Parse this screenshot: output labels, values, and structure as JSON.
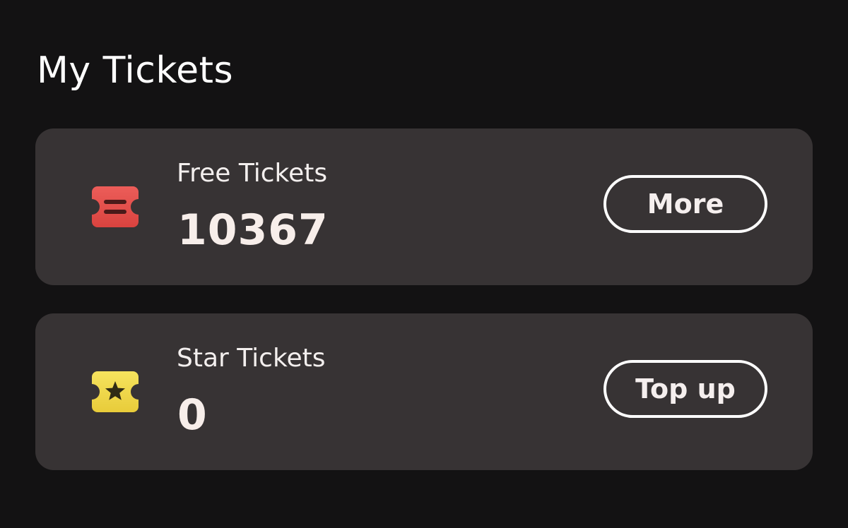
{
  "header": {
    "title": "My Tickets"
  },
  "cards": {
    "free": {
      "label": "Free Tickets",
      "count": "10367",
      "button_label": "More",
      "icon": "ticket-icon",
      "icon_color": "#e5524f"
    },
    "star": {
      "label": "Star Tickets",
      "count": "0",
      "button_label": "Top up",
      "icon": "star-ticket-icon",
      "icon_color": "#f0d84a"
    }
  },
  "colors": {
    "background": "#131213",
    "card_background": "#373334",
    "button_border": "#ffffff"
  }
}
